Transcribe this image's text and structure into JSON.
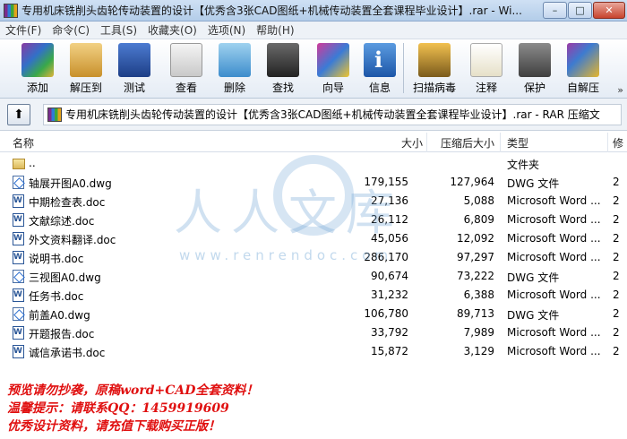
{
  "window": {
    "title": "专用机床铣削头齿轮传动装置的设计【优秀含3张CAD图纸+机械传动装置全套课程毕业设计】.rar - Wi...",
    "buttons": {
      "minimize": "–",
      "maximize": "□",
      "close": "✕"
    }
  },
  "menu": {
    "items": [
      "文件(F)",
      "命令(C)",
      "工具(S)",
      "收藏夹(O)",
      "选项(N)",
      "帮助(H)"
    ]
  },
  "toolbar": {
    "items": [
      {
        "label": "添加",
        "icon": "add-archive-icon"
      },
      {
        "label": "解压到",
        "icon": "extract-icon"
      },
      {
        "label": "测试",
        "icon": "test-icon"
      },
      {
        "label": "查看",
        "icon": "view-icon"
      },
      {
        "label": "删除",
        "icon": "delete-icon"
      },
      {
        "label": "查找",
        "icon": "binoculars-icon"
      },
      {
        "label": "向导",
        "icon": "wizard-icon"
      },
      {
        "label": "信息",
        "icon": "info-icon"
      },
      {
        "label": "扫描病毒",
        "icon": "scan-virus-icon"
      },
      {
        "label": "注释",
        "icon": "comment-icon"
      },
      {
        "label": "保护",
        "icon": "shield-icon"
      },
      {
        "label": "自解压",
        "icon": "sfx-icon"
      }
    ],
    "overflow": "»"
  },
  "address": {
    "up": "⬆",
    "path": "专用机床铣削头齿轮传动装置的设计【优秀含3张CAD图纸+机械传动装置全套课程毕业设计】.rar - RAR 压缩文"
  },
  "columns": {
    "name": "名称",
    "size": "大小",
    "packed": "压缩后大小",
    "type": "类型",
    "more": "修"
  },
  "files": [
    {
      "name": "..",
      "size": "",
      "packed": "",
      "type": "文件夹",
      "more": "",
      "kind": "folder"
    },
    {
      "name": "轴展开图A0.dwg",
      "size": "179,155",
      "packed": "127,964",
      "type": "DWG 文件",
      "more": "2",
      "kind": "dwg"
    },
    {
      "name": "中期检查表.doc",
      "size": "27,136",
      "packed": "5,088",
      "type": "Microsoft Word ...",
      "more": "2",
      "kind": "doc"
    },
    {
      "name": "文献综述.doc",
      "size": "26,112",
      "packed": "6,809",
      "type": "Microsoft Word ...",
      "more": "2",
      "kind": "doc"
    },
    {
      "name": "外文资料翻译.doc",
      "size": "45,056",
      "packed": "12,092",
      "type": "Microsoft Word ...",
      "more": "2",
      "kind": "doc"
    },
    {
      "name": "说明书.doc",
      "size": "286,170",
      "packed": "97,297",
      "type": "Microsoft Word ...",
      "more": "2",
      "kind": "doc"
    },
    {
      "name": "三视图A0.dwg",
      "size": "90,674",
      "packed": "73,222",
      "type": "DWG 文件",
      "more": "2",
      "kind": "dwg"
    },
    {
      "name": "任务书.doc",
      "size": "31,232",
      "packed": "6,388",
      "type": "Microsoft Word ...",
      "more": "2",
      "kind": "doc"
    },
    {
      "name": "前盖A0.dwg",
      "size": "106,780",
      "packed": "89,713",
      "type": "DWG 文件",
      "more": "2",
      "kind": "dwg"
    },
    {
      "name": "开题报告.doc",
      "size": "33,792",
      "packed": "7,989",
      "type": "Microsoft Word ...",
      "more": "2",
      "kind": "doc"
    },
    {
      "name": "诚信承诺书.doc",
      "size": "15,872",
      "packed": "3,129",
      "type": "Microsoft Word ...",
      "more": "2",
      "kind": "doc"
    }
  ],
  "watermark": {
    "text": "人人文库",
    "url": "www.renrendoc.com"
  },
  "notes": [
    "预览请勿抄袭，原稿word+CAD全套资料！",
    "温馨提示：请联系QQ：1459919609",
    "优秀设计资料，请充值下载购买正版！"
  ]
}
